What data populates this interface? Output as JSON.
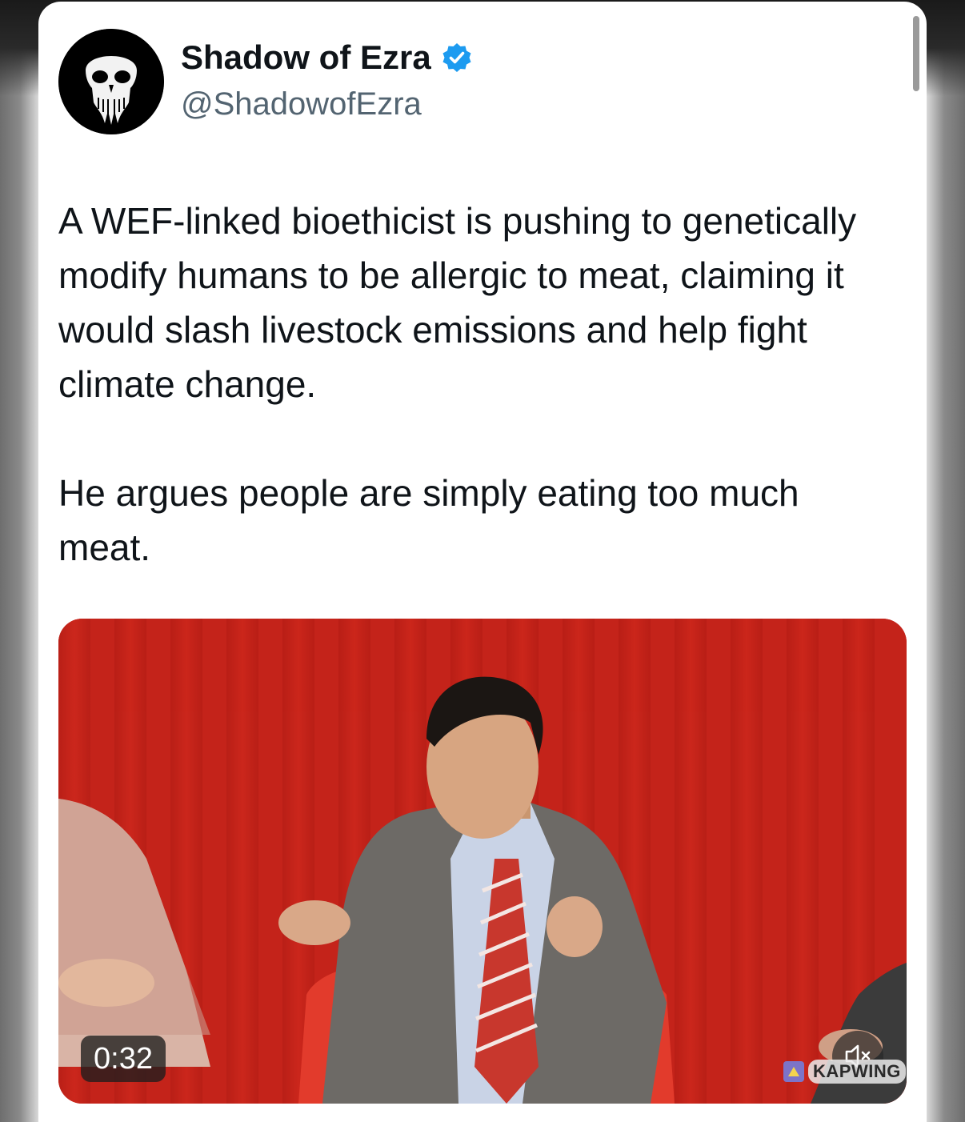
{
  "author": {
    "display_name": "Shadow of Ezra",
    "handle": "@ShadowofEzra",
    "verified_color": "#1d9bf0"
  },
  "tweet": {
    "paragraphs": [
      "A WEF-linked bioethicist is pushing to genetically modify humans to be allergic to meat, claiming it would slash livestock emissions and help fight climate change.",
      "He argues people are simply eating too much meat."
    ]
  },
  "media": {
    "type": "video",
    "duration": "0:32",
    "muted": true,
    "watermark": "KAPWING"
  },
  "colors": {
    "curtain": "#c4231a",
    "text": "#0f1419",
    "secondary_text": "#536471"
  }
}
